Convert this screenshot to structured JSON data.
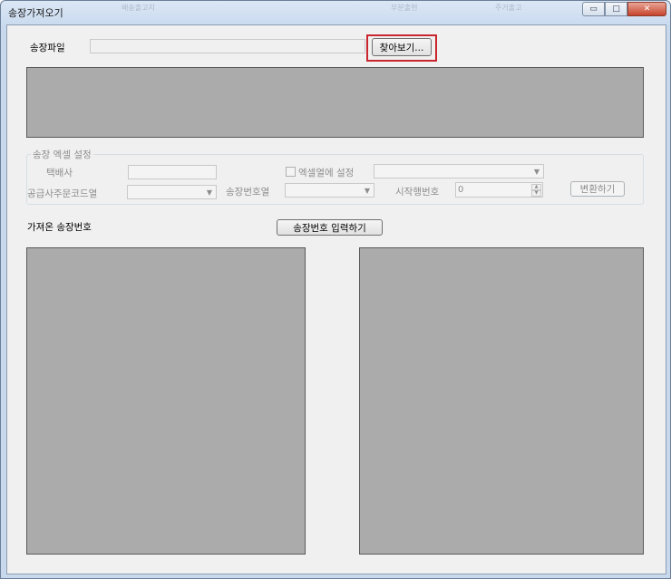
{
  "window": {
    "title": "송장가져오기",
    "background_captions": [
      "배송출고지",
      "부분출현",
      "주거출고"
    ]
  },
  "titlebar_buttons": {
    "minimize_icon": "minimize-icon",
    "maximize_icon": "maximize-icon",
    "close_icon": "close-icon",
    "minimize": "▭",
    "maximize": "□",
    "close": "✕"
  },
  "file": {
    "label": "송장파일",
    "path_value": "",
    "browse_label": "찾아보기..."
  },
  "excel_settings": {
    "group_title": "송장 엑셀 설정",
    "courier_label": "택배사",
    "courier_value": "",
    "excel_column_checkbox_label": "엑셀열에 설정",
    "excel_column_checked": false,
    "supplier_order_code_label": "공급사주문코드열",
    "invoice_number_column_label": "송장번호열",
    "start_row_label": "시작행번호",
    "start_row_value": "0",
    "convert_label": "변환하기"
  },
  "imported": {
    "label": "가져온 송장번호",
    "input_button_label": "송장번호 입력하기"
  },
  "colors": {
    "panel_gray": "#ababab",
    "highlight_red": "#c8252d",
    "disabled_text": "#8d8d8d"
  }
}
